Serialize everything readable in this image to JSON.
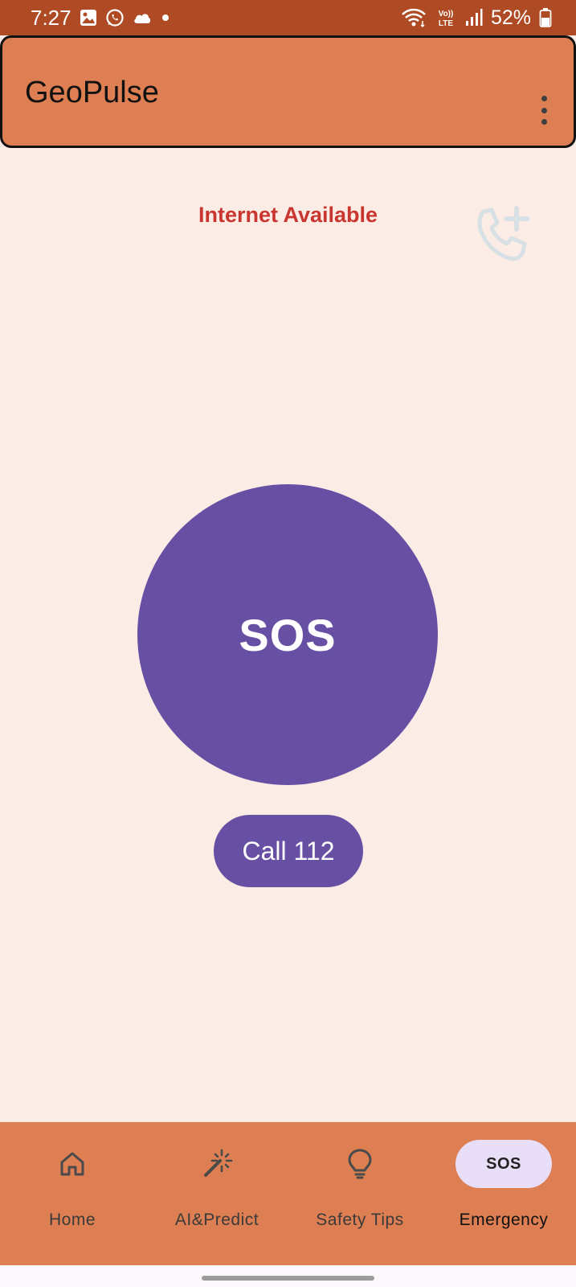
{
  "status_bar": {
    "time": "7:27",
    "battery": "52%",
    "volte": "Vo)) LTE",
    "notification_icons": [
      "gallery-icon",
      "whatsapp-icon",
      "cloud-icon",
      "dot-icon"
    ],
    "system_icons": [
      "wifi-icon",
      "volte-icon",
      "signal-icon",
      "battery-icon"
    ]
  },
  "app_bar": {
    "title": "GeoPulse",
    "menu_icon": "more-vert-icon"
  },
  "main": {
    "internet_status": "Internet Available",
    "add_call_icon": "add-call-icon",
    "sos_label": "SOS",
    "call_label": "Call 112"
  },
  "bottom_nav": {
    "items": [
      {
        "label": "Home",
        "icon": "home-icon"
      },
      {
        "label": "AI&Predict",
        "icon": "magic-wand-icon"
      },
      {
        "label": "Safety Tips",
        "icon": "lightbulb-icon"
      },
      {
        "label": "Emergency",
        "icon": "sos-icon",
        "icon_text": "SOS",
        "active": true
      }
    ]
  },
  "colors": {
    "status_bar": "#ae4a24",
    "app_bar": "#dd7f52",
    "background": "#fbece6",
    "primary": "#6750a4",
    "status_text": "#c9362f",
    "active_indicator": "#e8def8"
  }
}
